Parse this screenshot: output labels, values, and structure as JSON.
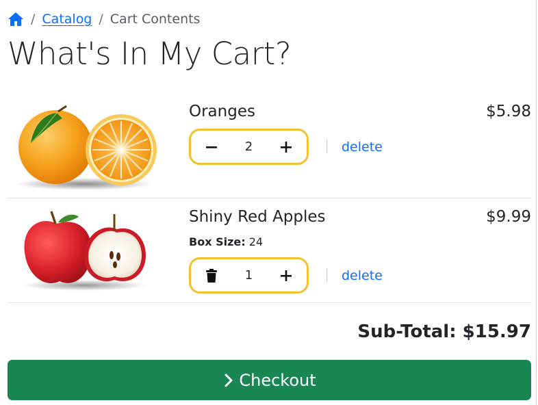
{
  "breadcrumb": {
    "home_icon": "home-icon",
    "separator": "/",
    "catalog_label": "Catalog",
    "current_label": "Cart Contents"
  },
  "page": {
    "title": "What's In My Cart?"
  },
  "cart": {
    "items": [
      {
        "name": "Oranges",
        "price": "$5.98",
        "quantity": "2",
        "decrement_icon": "minus-icon",
        "increment_icon": "plus-icon",
        "delete_label": "delete",
        "image": "oranges-image"
      },
      {
        "name": "Shiny Red Apples",
        "price": "$9.99",
        "attr_label": "Box Size:",
        "attr_value": "24",
        "quantity": "1",
        "decrement_icon": "trash-icon",
        "increment_icon": "plus-icon",
        "delete_label": "delete",
        "image": "apples-image"
      }
    ]
  },
  "summary": {
    "subtotal": "Sub-Total: $15.97"
  },
  "checkout": {
    "label": "Checkout",
    "icon": "chevron-right-icon"
  },
  "colors": {
    "link": "#0d6efd",
    "stepper_border": "#f3c12d",
    "checkout_bg": "#198754",
    "text": "#212529"
  }
}
